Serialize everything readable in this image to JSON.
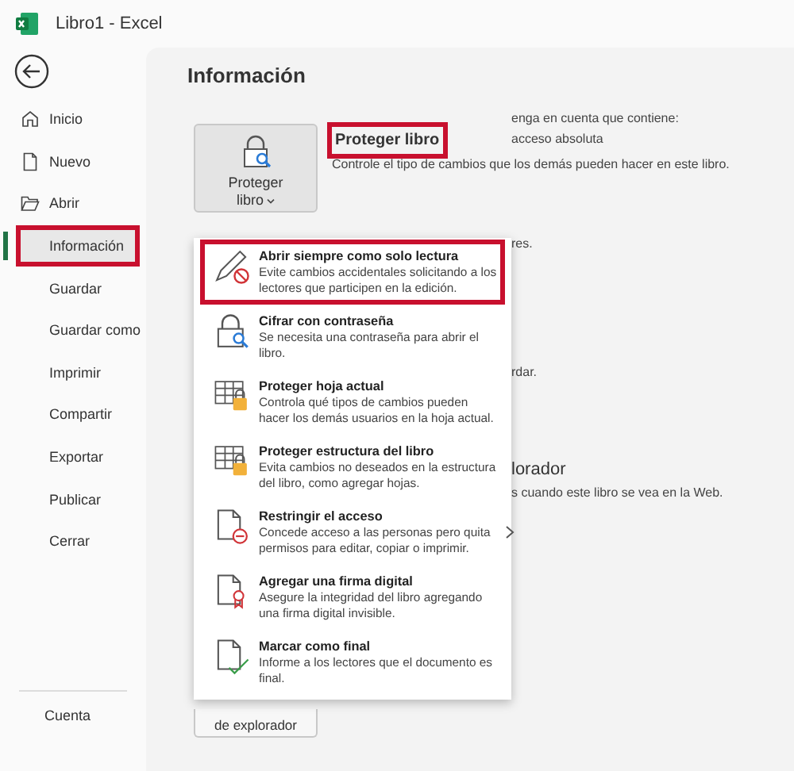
{
  "window": {
    "title": "Libro1 - Excel"
  },
  "sidebar": {
    "items": [
      {
        "label": "Inicio",
        "kind": "home",
        "selected": false,
        "highlighted": false
      },
      {
        "label": "Nuevo",
        "kind": "new",
        "selected": false,
        "highlighted": false
      },
      {
        "label": "Abrir",
        "kind": "open",
        "selected": false,
        "highlighted": false
      },
      {
        "label": "Información",
        "kind": "plain",
        "selected": true,
        "highlighted": true
      },
      {
        "label": "Guardar",
        "kind": "plain",
        "selected": false,
        "highlighted": false
      },
      {
        "label": "Guardar como",
        "kind": "plain",
        "selected": false,
        "highlighted": false
      },
      {
        "label": "Imprimir",
        "kind": "plain",
        "selected": false,
        "highlighted": false
      },
      {
        "label": "Compartir",
        "kind": "plain",
        "selected": false,
        "highlighted": false
      },
      {
        "label": "Exportar",
        "kind": "plain",
        "selected": false,
        "highlighted": false
      },
      {
        "label": "Publicar",
        "kind": "plain",
        "selected": false,
        "highlighted": false
      },
      {
        "label": "Cerrar",
        "kind": "plain",
        "selected": false,
        "highlighted": false
      }
    ],
    "bottom_items": [
      {
        "label": "Cuenta"
      }
    ]
  },
  "page": {
    "title": "Información",
    "protect_button": {
      "label": "Proteger libro"
    },
    "protect_heading": {
      "text": "Proteger libro",
      "highlighted": true
    },
    "protect_description": "Controle el tipo de cambios que los demás pueden hacer en este libro.",
    "background_fragments": [
      {
        "text": "enga en cuenta que contiene:",
        "kind": "line"
      },
      {
        "text": "acceso absoluta",
        "kind": "line"
      },
      {
        "text": "res.",
        "kind": "line"
      },
      {
        "text": "rdar.",
        "kind": "line"
      },
      {
        "text": "lorador",
        "kind": "heading"
      },
      {
        "text": "s cuando este libro se vea en la Web.",
        "kind": "line"
      }
    ],
    "browser_button": {
      "label": "de explorador"
    }
  },
  "menu": {
    "items": [
      {
        "kind": "pencil",
        "title": "Abrir siempre como solo lectura",
        "description": "Evite cambios accidentales solicitando a los lectores que participen en la edición.",
        "highlighted": true,
        "submenu": false
      },
      {
        "kind": "lock",
        "title": "Cifrar con contraseña",
        "description": "Se necesita una contraseña para abrir el libro.",
        "highlighted": false,
        "submenu": false
      },
      {
        "kind": "sheet",
        "title": "Proteger hoja actual",
        "description": "Controla qué tipos de cambios pueden hacer los demás usuarios en la hoja actual.",
        "highlighted": false,
        "submenu": false
      },
      {
        "kind": "sheet",
        "title": "Proteger estructura del libro",
        "description": "Evita cambios no deseados en la estructura del libro, como agregar hojas.",
        "highlighted": false,
        "submenu": false
      },
      {
        "kind": "restrict",
        "title": "Restringir el acceso",
        "description": "Concede acceso a las personas pero quita permisos para editar, copiar o imprimir.",
        "highlighted": false,
        "submenu": true
      },
      {
        "kind": "ribbon",
        "title": "Agregar una firma digital",
        "description": "Asegure la integridad del libro agregando una firma digital invisible.",
        "highlighted": false,
        "submenu": false
      },
      {
        "kind": "check",
        "title": "Marcar como final",
        "description": "Informe a los lectores que el documento es final.",
        "highlighted": false,
        "submenu": false
      }
    ]
  }
}
